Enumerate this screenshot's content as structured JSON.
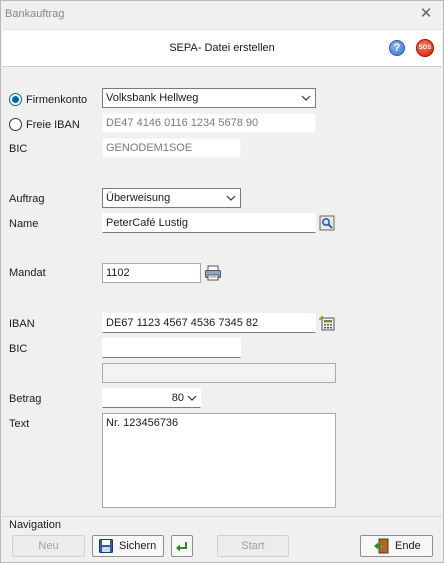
{
  "window": {
    "title": "Bankauftrag",
    "close_glyph": "✕"
  },
  "header": {
    "title": "SEPA- Datei erstellen",
    "help_icon": "?",
    "sos_icon": "SOS"
  },
  "account": {
    "firmenkonto_label": "Firmenkonto",
    "firmenkonto_value": "Volksbank Hellweg",
    "freie_iban_label": "Freie IBAN",
    "freie_iban_value": "DE47 4146 0116 1234 5678 90",
    "bic_label": "BIC",
    "bic_value": "GENODEM1SOE"
  },
  "order": {
    "auftrag_label": "Auftrag",
    "auftrag_value": "Überweisung",
    "name_label": "Name",
    "name_value": "PeterCafé Lustig",
    "mandat_label": "Mandat",
    "mandat_value": "1102",
    "iban_label": "IBAN",
    "iban_value": "DE67 1123 4567 4536 7345 82",
    "bic_label": "BIC",
    "bic_value": "",
    "extra_value": "",
    "betrag_label": "Betrag",
    "betrag_value": "80",
    "text_label": "Text",
    "text_value": "Nr. 123456736"
  },
  "navigation": {
    "label": "Navigation",
    "neu_label": "Neu",
    "sichern_label": "Sichern",
    "start_label": "Start",
    "ende_label": "Ende"
  }
}
